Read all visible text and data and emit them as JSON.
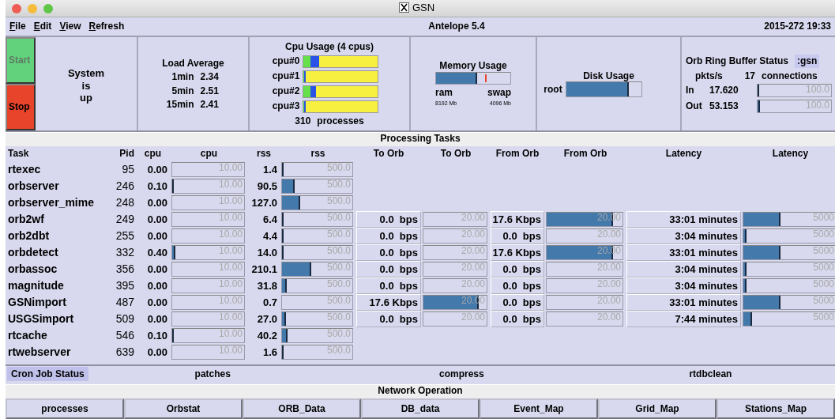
{
  "window": {
    "title": "GSN"
  },
  "menu": [
    "File",
    "Edit",
    "View",
    "Refresh"
  ],
  "version": "Antelope 5.4",
  "clock": "2015-272 19:33",
  "controls": [
    {
      "label": "Start",
      "kind": "start",
      "disabled": true
    },
    {
      "label": "Stop",
      "kind": "stop",
      "disabled": false
    }
  ],
  "system_status": [
    "System",
    "is",
    "up"
  ],
  "load_average": {
    "title": "Load Average",
    "rows": [
      {
        "label": "1min",
        "value": "2.34"
      },
      {
        "label": "5min",
        "value": "2.51"
      },
      {
        "label": "15min",
        "value": "2.41"
      }
    ]
  },
  "cpu_usage": {
    "title": "Cpu Usage (4 cpus)",
    "cpus": [
      {
        "label": "cpu#0",
        "segments": [
          {
            "level": 0.09,
            "color": "#66e04a"
          },
          {
            "level": 0.12,
            "color": "#2a52e8"
          }
        ]
      },
      {
        "label": "cpu#1",
        "segments": [
          {
            "level": 0.01,
            "color": "#66e04a"
          },
          {
            "level": 0.02,
            "color": "#2a52e8"
          }
        ]
      },
      {
        "label": "cpu#2",
        "segments": [
          {
            "level": 0.09,
            "color": "#66e04a"
          },
          {
            "level": 0.08,
            "color": "#2a52e8"
          }
        ]
      },
      {
        "label": "cpu#3",
        "segments": [
          {
            "level": 0.005,
            "color": "#66e04a"
          },
          {
            "level": 0.02,
            "color": "#2a52e8"
          }
        ]
      }
    ],
    "processes": "310",
    "processes_label": "processes"
  },
  "memory": {
    "title": "Memory Usage",
    "ram": {
      "label": "ram",
      "size": "8192 Mb",
      "level": 0.55
    },
    "swap": {
      "label": "swap",
      "size": "4096 Mb",
      "level": 0.66
    }
  },
  "disk": {
    "title": "Disk Usage",
    "disks": [
      {
        "label": "root",
        "level": 0.84
      }
    ]
  },
  "orb": {
    "title": "Orb Ring Buffer Status",
    "name": ":gsn",
    "pkts_label": "pkts/s",
    "connections": "17",
    "connections_label": "connections",
    "rows": [
      {
        "label": "In",
        "value": "17.620",
        "level": 0.01,
        "scale": "100.0"
      },
      {
        "label": "Out",
        "value": "53.153",
        "level": 0.03,
        "scale": "100.0"
      }
    ]
  },
  "processing": {
    "title": "Processing Tasks",
    "columns": [
      "Task",
      "Pid",
      "cpu",
      "cpu",
      "rss",
      "rss",
      "To Orb",
      "To Orb",
      "From Orb",
      "From Orb",
      "Latency",
      "Latency"
    ],
    "rows": [
      {
        "task": "rtexec",
        "pid": "95",
        "cpu": {
          "value": "0.00",
          "scale": "10.00"
        },
        "rss": {
          "value": "1.4",
          "level": 0.003,
          "scale": "500.0"
        }
      },
      {
        "task": "orbserver",
        "pid": "246",
        "cpu": {
          "value": "0.10",
          "level": 0.01,
          "scale": "10.00"
        },
        "rss": {
          "value": "90.5",
          "level": 0.18,
          "scale": "500.0"
        }
      },
      {
        "task": "orbserver_mime",
        "pid": "248",
        "cpu": {
          "value": "0.00",
          "scale": "10.00"
        },
        "rss": {
          "value": "127.0",
          "level": 0.254,
          "scale": "500.0"
        }
      },
      {
        "task": "orb2wf",
        "pid": "249",
        "cpu": {
          "value": "0.00",
          "scale": "10.00"
        },
        "rss": {
          "value": "6.4",
          "level": 0.013,
          "scale": "500.0"
        },
        "to_orb": {
          "value": "0.0  bps",
          "scale": "20.00"
        },
        "from_orb": {
          "value": "17.6 Kbps",
          "level": 0.88,
          "scale": "20.00"
        },
        "latency": {
          "value": "33:01 minutes",
          "level": 0.4,
          "scale": "5000"
        }
      },
      {
        "task": "orb2dbt",
        "pid": "255",
        "cpu": {
          "value": "0.00",
          "scale": "10.00"
        },
        "rss": {
          "value": "4.4",
          "level": 0.009,
          "scale": "500.0"
        },
        "to_orb": {
          "value": "0.0  bps",
          "scale": "20.00"
        },
        "from_orb": {
          "value": "0.0  bps",
          "scale": "20.00"
        },
        "latency": {
          "value": "3:04 minutes",
          "level": 0.037,
          "scale": "5000"
        }
      },
      {
        "task": "orbdetect",
        "pid": "332",
        "cpu": {
          "value": "0.40",
          "level": 0.04,
          "scale": "10.00"
        },
        "rss": {
          "value": "14.0",
          "level": 0.028,
          "scale": "500.0"
        },
        "to_orb": {
          "value": "0.0  bps",
          "scale": "20.00"
        },
        "from_orb": {
          "value": "17.6 Kbps",
          "level": 0.88,
          "scale": "20.00"
        },
        "latency": {
          "value": "33:01 minutes",
          "level": 0.4,
          "scale": "5000"
        }
      },
      {
        "task": "orbassoc",
        "pid": "356",
        "cpu": {
          "value": "0.00",
          "scale": "10.00"
        },
        "rss": {
          "value": "210.1",
          "level": 0.42,
          "scale": "500.0"
        },
        "to_orb": {
          "value": "0.0  bps",
          "scale": "20.00"
        },
        "from_orb": {
          "value": "0.0  bps",
          "scale": "20.00"
        },
        "latency": {
          "value": "3:04 minutes",
          "level": 0.037,
          "scale": "5000"
        }
      },
      {
        "task": "magnitude",
        "pid": "395",
        "cpu": {
          "value": "0.00",
          "scale": "10.00"
        },
        "rss": {
          "value": "31.8",
          "level": 0.064,
          "scale": "500.0"
        },
        "to_orb": {
          "value": "0.0  bps",
          "scale": "20.00"
        },
        "from_orb": {
          "value": "0.0  bps",
          "scale": "20.00"
        },
        "latency": {
          "value": "3:04 minutes",
          "level": 0.037,
          "scale": "5000"
        }
      },
      {
        "task": "GSNimport",
        "pid": "487",
        "cpu": {
          "value": "0.00",
          "scale": "10.00"
        },
        "rss": {
          "value": "0.7",
          "scale": "500.0"
        },
        "to_orb": {
          "value": "17.6 Kbps",
          "level": 0.88,
          "scale": "20.00"
        },
        "from_orb": {
          "value": "0.0  bps",
          "scale": "20.00"
        },
        "latency": {
          "value": "33:01 minutes",
          "level": 0.4,
          "scale": "5000"
        }
      },
      {
        "task": "USGSimport",
        "pid": "509",
        "cpu": {
          "value": "0.00",
          "scale": "10.00"
        },
        "rss": {
          "value": "27.0",
          "level": 0.054,
          "scale": "500.0"
        },
        "to_orb": {
          "value": "0.0  bps",
          "scale": "20.00"
        },
        "from_orb": {
          "value": "0.0  bps",
          "scale": "20.00"
        },
        "latency": {
          "value": "7:44 minutes",
          "level": 0.093,
          "scale": "5000"
        }
      },
      {
        "task": "rtcache",
        "pid": "546",
        "cpu": {
          "value": "0.10",
          "level": 0.01,
          "scale": "10.00"
        },
        "rss": {
          "value": "40.2",
          "level": 0.08,
          "scale": "500.0"
        }
      },
      {
        "task": "rtwebserver",
        "pid": "639",
        "cpu": {
          "value": "0.00",
          "scale": "10.00"
        },
        "rss": {
          "value": "1.6",
          "level": 0.003,
          "scale": "500.0"
        }
      }
    ]
  },
  "cron": {
    "title": "Cron Job Status",
    "jobs": [
      "patches",
      "compress",
      "rtdbclean"
    ]
  },
  "network": {
    "title": "Network Operation",
    "buttons": [
      "processes",
      "Orbstat",
      "ORB_Data",
      "DB_data",
      "Event_Map",
      "Grid_Map",
      "Stations_Map"
    ]
  }
}
